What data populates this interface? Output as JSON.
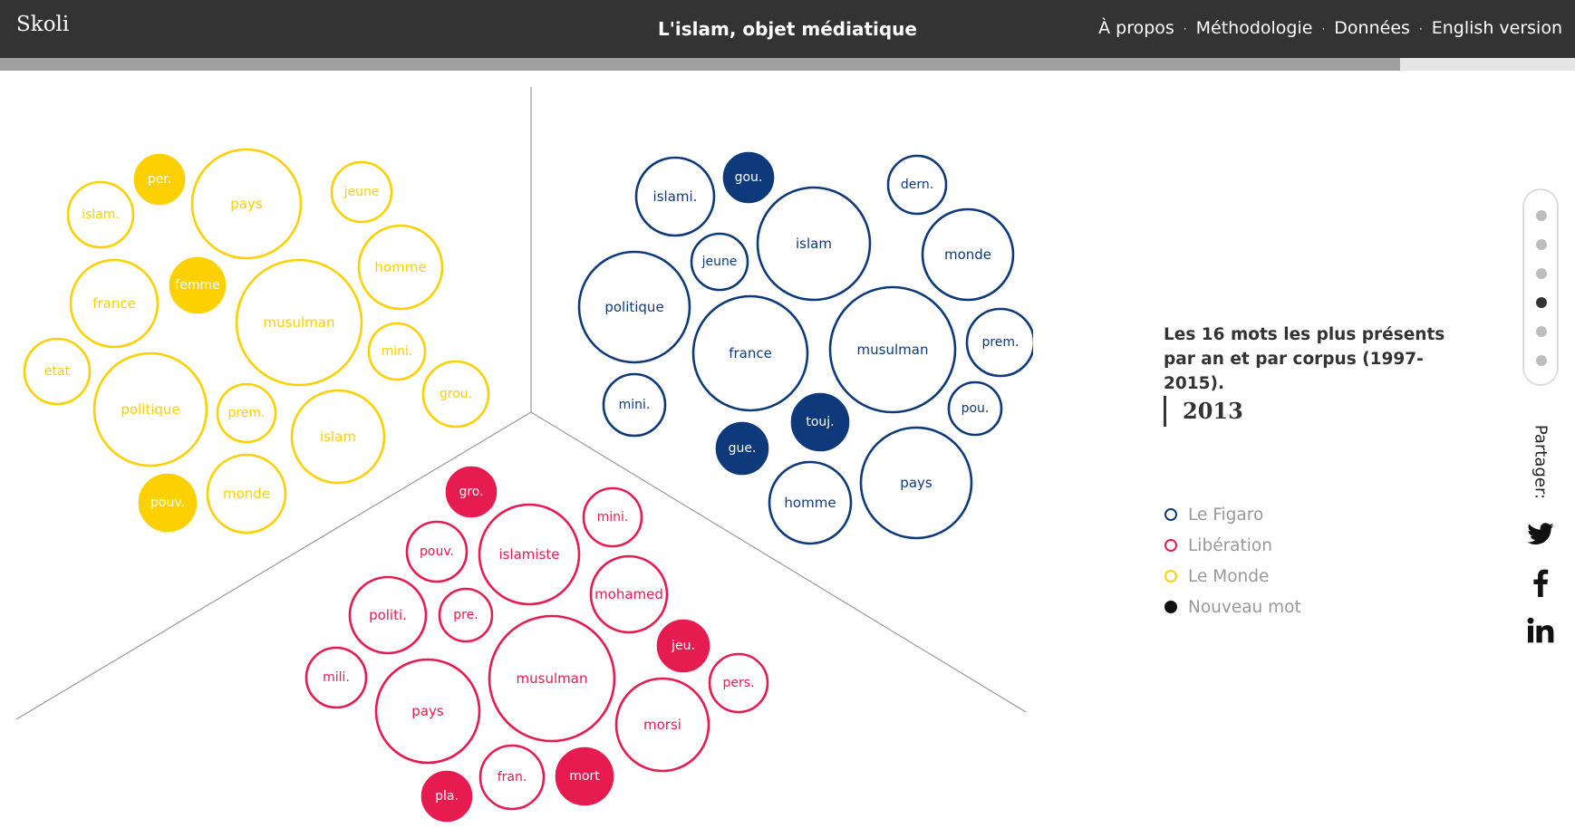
{
  "header": {
    "logo": "Skoli",
    "title": "L'islam, objet médiatique",
    "nav": [
      "À propos",
      "Méthodologie",
      "Données",
      "English version"
    ],
    "separator": "·"
  },
  "timeline_progress": 0.889,
  "description": "Les 16 mots les plus présents par an et par corpus (1997-2015).",
  "year": "2013",
  "legend": [
    {
      "label": "Le Figaro",
      "color": "#0e3a7c",
      "filled": false
    },
    {
      "label": "Libération",
      "color": "#e61b4f",
      "filled": false
    },
    {
      "label": "Le Monde",
      "color": "#fcd001",
      "filled": false
    },
    {
      "label": "Nouveau mot",
      "color": "#111111",
      "filled": true
    }
  ],
  "year_navigation": {
    "count": 6,
    "active_index": 3
  },
  "share": {
    "label": "Partager:",
    "networks": [
      "twitter-icon",
      "facebook-icon",
      "linkedin-icon"
    ]
  },
  "chart_data": {
    "type": "bubble",
    "groups": [
      {
        "name": "Le Monde",
        "color": "#fcd001",
        "words": [
          {
            "label": "per.",
            "new": true
          },
          {
            "label": "pays",
            "new": false
          },
          {
            "label": "jeune",
            "new": false
          },
          {
            "label": "islam.",
            "new": false
          },
          {
            "label": "homme",
            "new": false
          },
          {
            "label": "femme",
            "new": true
          },
          {
            "label": "france",
            "new": false
          },
          {
            "label": "musulman",
            "new": false
          },
          {
            "label": "mini.",
            "new": false
          },
          {
            "label": "etat",
            "new": false
          },
          {
            "label": "grou.",
            "new": false
          },
          {
            "label": "politique",
            "new": false
          },
          {
            "label": "prem.",
            "new": false
          },
          {
            "label": "islam",
            "new": false
          },
          {
            "label": "pouv.",
            "new": true
          },
          {
            "label": "monde",
            "new": false
          }
        ]
      },
      {
        "name": "Le Figaro",
        "color": "#0e3a7c",
        "words": [
          {
            "label": "gou.",
            "new": true
          },
          {
            "label": "islami.",
            "new": false
          },
          {
            "label": "dern.",
            "new": false
          },
          {
            "label": "islam",
            "new": false
          },
          {
            "label": "jeune",
            "new": false
          },
          {
            "label": "monde",
            "new": false
          },
          {
            "label": "politique",
            "new": false
          },
          {
            "label": "prem.",
            "new": false
          },
          {
            "label": "france",
            "new": false
          },
          {
            "label": "musulman",
            "new": false
          },
          {
            "label": "mini.",
            "new": false
          },
          {
            "label": "pou.",
            "new": false
          },
          {
            "label": "touj.",
            "new": true
          },
          {
            "label": "gue.",
            "new": true
          },
          {
            "label": "pays",
            "new": false
          },
          {
            "label": "homme",
            "new": false
          }
        ]
      },
      {
        "name": "Libération",
        "color": "#e61b4f",
        "words": [
          {
            "label": "gro.",
            "new": true
          },
          {
            "label": "mini.",
            "new": false
          },
          {
            "label": "pouv.",
            "new": false
          },
          {
            "label": "islamiste",
            "new": false
          },
          {
            "label": "mohamed",
            "new": false
          },
          {
            "label": "politi.",
            "new": false
          },
          {
            "label": "pre.",
            "new": false
          },
          {
            "label": "jeu.",
            "new": true
          },
          {
            "label": "mili.",
            "new": false
          },
          {
            "label": "musulman",
            "new": false
          },
          {
            "label": "pers.",
            "new": false
          },
          {
            "label": "pays",
            "new": false
          },
          {
            "label": "morsi",
            "new": false
          },
          {
            "label": "mort",
            "new": true
          },
          {
            "label": "fran.",
            "new": false
          },
          {
            "label": "pla.",
            "new": true
          }
        ]
      }
    ]
  }
}
